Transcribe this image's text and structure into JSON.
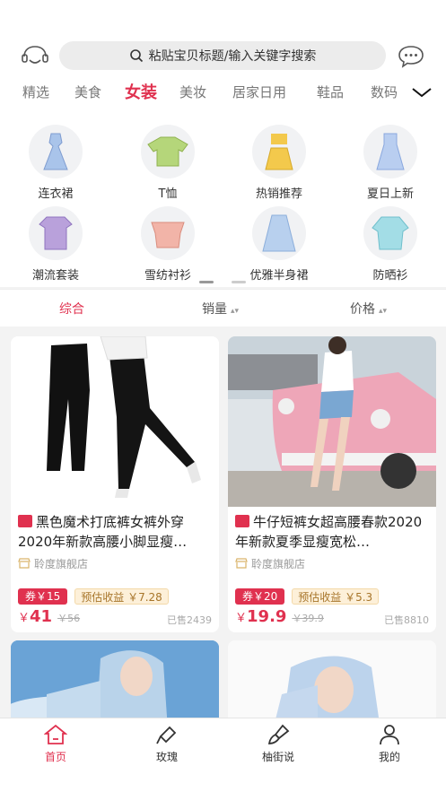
{
  "search": {
    "placeholder": "粘贴宝贝标题/输入关键字搜索"
  },
  "categories": [
    "精选",
    "美食",
    "女装",
    "美妆",
    "居家日用",
    "鞋品",
    "数码"
  ],
  "active_category": "女装",
  "grid": [
    {
      "label": "连衣裙",
      "icon": "dress-icon",
      "color": "#a9c4ea"
    },
    {
      "label": "T恤",
      "icon": "tshirt-icon",
      "color": "#b5d67a"
    },
    {
      "label": "热销推荐",
      "icon": "hot-dress-icon",
      "color": "#f3c94c"
    },
    {
      "label": "夏日上新",
      "icon": "summer-dress-icon",
      "color": "#b9cef0"
    },
    {
      "label": "潮流套装",
      "icon": "outfit-icon",
      "color": "#b9a1db"
    },
    {
      "label": "雪纺衬衫",
      "icon": "chiffon-shirt-icon",
      "color": "#f2b4a8"
    },
    {
      "label": "优雅半身裙",
      "icon": "skirt-icon",
      "color": "#b8d0ee"
    },
    {
      "label": "防晒衫",
      "icon": "sun-shirt-icon",
      "color": "#a3dde6"
    }
  ],
  "sort": {
    "comprehensive": "综合",
    "sales": "销量",
    "price": "价格"
  },
  "products": [
    {
      "title": "黑色魔术打底裤女裤外穿2020年新款高腰小脚显瘦…",
      "shop": "聆度旗舰店",
      "coupon": "券￥15",
      "earn": "预估收益 ￥7.28",
      "currency": "￥",
      "price": "41",
      "orig": "￥56",
      "sold": "已售2439"
    },
    {
      "title": "牛仔短裤女超高腰春款2020年新款夏季显瘦宽松…",
      "shop": "聆度旗舰店",
      "coupon": "券￥20",
      "earn": "预估收益 ￥5.3",
      "currency": "￥",
      "price": "19.9",
      "orig": "￥39.9",
      "sold": "已售8810"
    }
  ],
  "tabs": [
    {
      "label": "首页",
      "icon": "home-icon"
    },
    {
      "label": "玫瑰",
      "icon": "rose-icon"
    },
    {
      "label": "柚街说",
      "icon": "brush-icon"
    },
    {
      "label": "我的",
      "icon": "user-icon"
    }
  ],
  "colors": {
    "accent": "#e0314f",
    "earn_bg": "#fdf0d9",
    "earn_text": "#a7752a"
  }
}
